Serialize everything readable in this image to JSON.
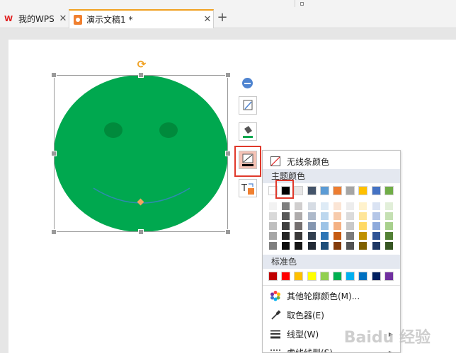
{
  "tabs": [
    {
      "label": "我的WPS",
      "active": false
    },
    {
      "label": "演示文稿1 *",
      "active": true
    }
  ],
  "menu": {
    "no_line_label": "无线条颜色",
    "theme_section": "主题颜色",
    "standard_section": "标准色",
    "more_colors_label": "其他轮廓颜色(M)...",
    "eyedropper_label": "取色器(E)",
    "line_style_label": "线型(W)",
    "dash_style_label": "虚线线型(S)",
    "theme_top_colors": [
      "#ffffff",
      "#000000",
      "#e7e6e6",
      "#44546a",
      "#5b9bd5",
      "#ed7d31",
      "#a5a5a5",
      "#ffc000",
      "#4472c4",
      "#70ad47"
    ],
    "theme_shade_rows": [
      [
        "#f2f2f2",
        "#7f7f7f",
        "#d0cece",
        "#d6dce4",
        "#deebf6",
        "#fbe5d5",
        "#ededed",
        "#fff2cc",
        "#dae3f3",
        "#e2efd9"
      ],
      [
        "#d9d9d9",
        "#595959",
        "#aeabab",
        "#adb9ca",
        "#bdd7ee",
        "#f7cbac",
        "#dbdbdb",
        "#fee599",
        "#b4c6e7",
        "#c5e0b3"
      ],
      [
        "#bfbfbf",
        "#3f3f3f",
        "#757070",
        "#8496b0",
        "#9dc3e6",
        "#f4b183",
        "#c9c9c9",
        "#ffd966",
        "#8eaadb",
        "#a8d08d"
      ],
      [
        "#a6a6a6",
        "#262626",
        "#3a3838",
        "#323f4f",
        "#2e75b5",
        "#c55a11",
        "#7b7b7b",
        "#bf9000",
        "#2f5496",
        "#538135"
      ],
      [
        "#7f7f7f",
        "#0d0d0d",
        "#161616",
        "#222a35",
        "#1e4e79",
        "#833c0b",
        "#525252",
        "#7f6000",
        "#1f3864",
        "#375623"
      ]
    ],
    "standard_colors": [
      "#c00000",
      "#ff0000",
      "#ffc000",
      "#ffff00",
      "#92d050",
      "#00b050",
      "#00b0f0",
      "#0070c0",
      "#002060",
      "#7030a0"
    ]
  },
  "shape": {
    "fill": "#00a84f",
    "eye": "#008a3c",
    "mouth": "#2e8bb0"
  },
  "accent": {
    "selection_highlight": "#e0392b",
    "tab_accent": "#f0a020"
  },
  "watermark": "Baidu 经验"
}
